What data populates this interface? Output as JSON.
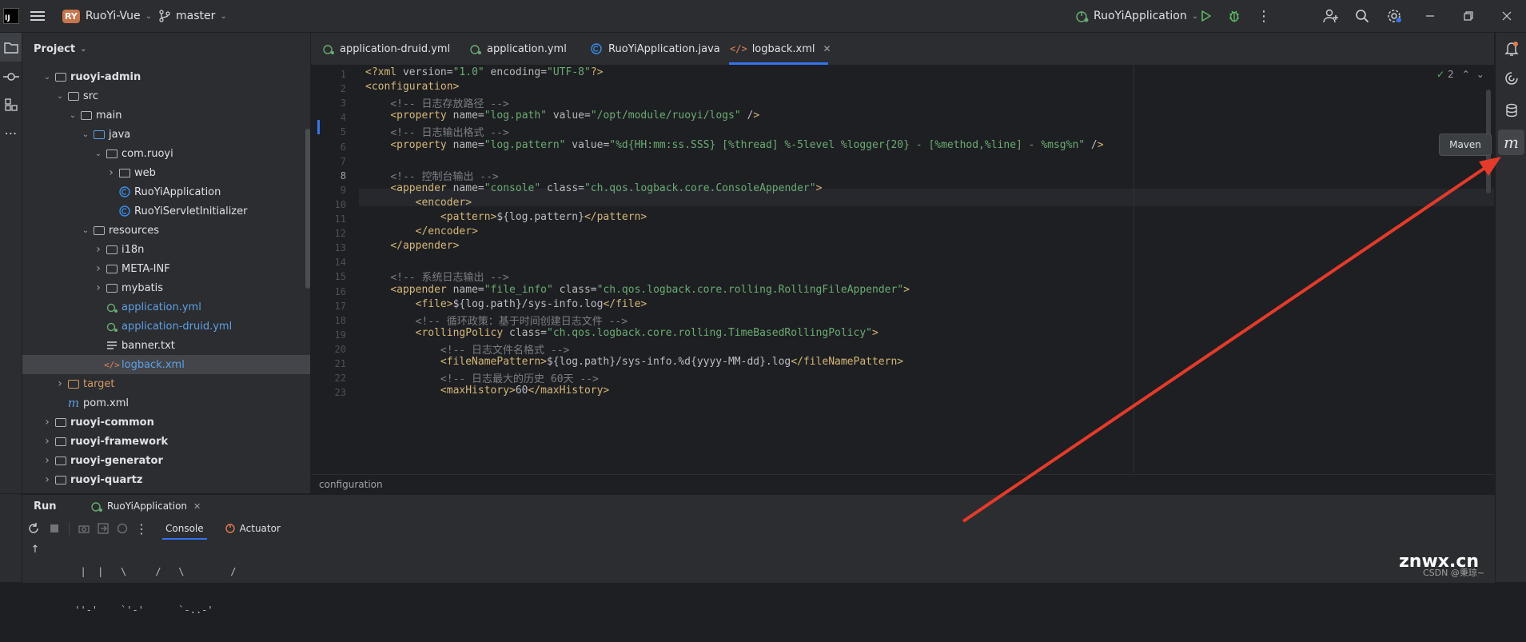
{
  "titlebar": {
    "logo": "IJ",
    "project_badge": "RY",
    "project_name": "RuoYi-Vue",
    "branch": "master",
    "run_config": "RuoYiApplication",
    "icons": [
      "menu-icon",
      "branch-icon",
      "run-icon",
      "debug-icon",
      "more-icon",
      "add-user-icon",
      "search-icon",
      "settings-icon",
      "minimize-icon",
      "restore-icon",
      "close-icon"
    ]
  },
  "project_panel": {
    "title": "Project",
    "rows": [
      {
        "label": "ruoyi-admin",
        "depth": 1,
        "expanded": true,
        "kind": "module",
        "bold": true
      },
      {
        "label": "src",
        "depth": 2,
        "expanded": true,
        "kind": "folder"
      },
      {
        "label": "main",
        "depth": 3,
        "expanded": true,
        "kind": "folder"
      },
      {
        "label": "java",
        "depth": 4,
        "expanded": true,
        "kind": "folder-blue"
      },
      {
        "label": "com.ruoyi",
        "depth": 5,
        "expanded": true,
        "kind": "package"
      },
      {
        "label": "web",
        "depth": 6,
        "expanded": false,
        "kind": "package"
      },
      {
        "label": "RuoYiApplication",
        "depth": 6,
        "kind": "class"
      },
      {
        "label": "RuoYiServletInitializer",
        "depth": 6,
        "kind": "class"
      },
      {
        "label": "resources",
        "depth": 4,
        "expanded": true,
        "kind": "folder-res"
      },
      {
        "label": "i18n",
        "depth": 5,
        "expanded": false,
        "kind": "folder"
      },
      {
        "label": "META-INF",
        "depth": 5,
        "expanded": false,
        "kind": "folder"
      },
      {
        "label": "mybatis",
        "depth": 5,
        "expanded": false,
        "kind": "folder"
      },
      {
        "label": "application.yml",
        "depth": 5,
        "kind": "yml",
        "color": "#5fa0e6"
      },
      {
        "label": "application-druid.yml",
        "depth": 5,
        "kind": "yml",
        "color": "#5fa0e6"
      },
      {
        "label": "banner.txt",
        "depth": 5,
        "kind": "txt"
      },
      {
        "label": "logback.xml",
        "depth": 5,
        "kind": "xml",
        "color": "#5fa0e6",
        "selected": true
      },
      {
        "label": "target",
        "depth": 2,
        "expanded": false,
        "kind": "folder-orange",
        "color": "#d19a66"
      },
      {
        "label": "pom.xml",
        "depth": 2,
        "kind": "maven"
      },
      {
        "label": "ruoyi-common",
        "depth": 1,
        "expanded": false,
        "kind": "module",
        "bold": true
      },
      {
        "label": "ruoyi-framework",
        "depth": 1,
        "expanded": false,
        "kind": "module",
        "bold": true
      },
      {
        "label": "ruoyi-generator",
        "depth": 1,
        "expanded": false,
        "kind": "module",
        "bold": true
      },
      {
        "label": "ruoyi-quartz",
        "depth": 1,
        "expanded": false,
        "kind": "module",
        "bold": true
      }
    ]
  },
  "tabs": [
    {
      "label": "application-druid.yml",
      "icon": "yml-icon"
    },
    {
      "label": "application.yml",
      "icon": "yml-icon"
    },
    {
      "label": "RuoYiApplication.java",
      "icon": "class-icon"
    },
    {
      "label": "logback.xml",
      "icon": "xml-icon",
      "active": true
    }
  ],
  "editor": {
    "inspection_count": "2",
    "line_numbers": [
      "1",
      "2",
      "3",
      "4",
      "5",
      "6",
      "7",
      "8",
      "9",
      "10",
      "11",
      "12",
      "13",
      "14",
      "15",
      "16",
      "17",
      "18",
      "19",
      "20",
      "21",
      "22",
      "23"
    ],
    "lines": [
      "<?xml version=\"1.0\" encoding=\"UTF-8\"?>",
      "<configuration>",
      "    <!-- 日志存放路径 -->",
      "    <property name=\"log.path\" value=\"/opt/module/ruoyi/logs\" />",
      "    <!-- 日志输出格式 -->",
      "    <property name=\"log.pattern\" value=\"%d{HH:mm:ss.SSS} [%thread] %-5level %logger{20} - [%method,%line] - %msg%n\" />",
      "",
      "    <!-- 控制台输出 -->",
      "    <appender name=\"console\" class=\"ch.qos.logback.core.ConsoleAppender\">",
      "        <encoder>",
      "            <pattern>${log.pattern}</pattern>",
      "        </encoder>",
      "    </appender>",
      "",
      "    <!-- 系统日志输出 -->",
      "    <appender name=\"file_info\" class=\"ch.qos.logback.core.rolling.RollingFileAppender\">",
      "        <file>${log.path}/sys-info.log</file>",
      "        <!-- 循环政策：基于时间创建日志文件 -->",
      "        <rollingPolicy class=\"ch.qos.logback.core.rolling.TimeBasedRollingPolicy\">",
      "            <!-- 日志文件名格式 -->",
      "            <fileNamePattern>${log.path}/sys-info.%d{yyyy-MM-dd}.log</fileNamePattern>",
      "            <!-- 日志最大的历史 60天 -->",
      "            <maxHistory>60</maxHistory>"
    ]
  },
  "breadcrumb": "configuration",
  "run_panel": {
    "title": "Run",
    "config_tab": "RuoYiApplication",
    "tabs": [
      "Console",
      "Actuator"
    ],
    "console_lines": [
      "  |  |   \\     /   \\        /",
      " ''-'    `'-'      `-..-'"
    ]
  },
  "tooltip": "Maven",
  "watermark": "znwx.cn",
  "watermark_sub": "CSDN @秉琼~",
  "accent": "#3574f0",
  "annotation_arrow_color": "#e53a2a"
}
